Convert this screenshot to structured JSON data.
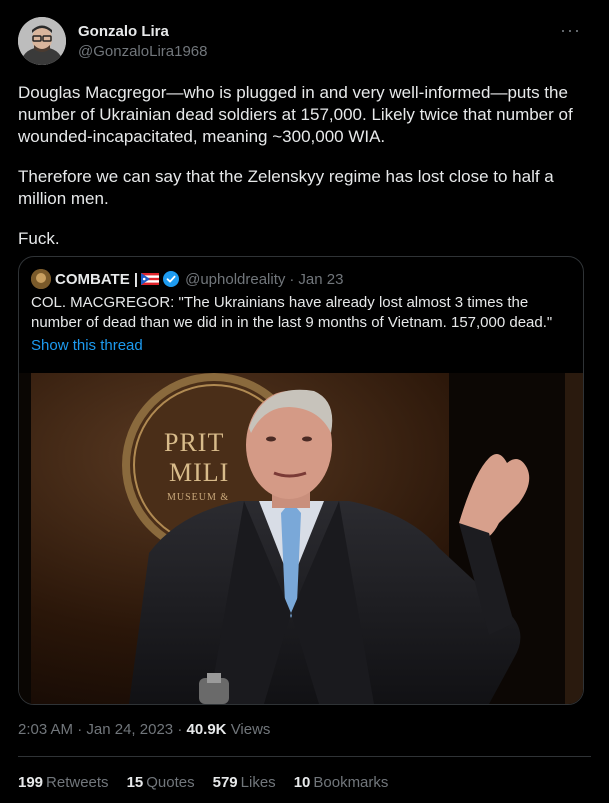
{
  "author": {
    "name": "Gonzalo Lira",
    "handle": "@GonzaloLira1968",
    "more_icon": "···"
  },
  "tweet": {
    "paragraphs": [
      "Douglas Macgregor—who is plugged in and very well-informed—puts the number of Ukrainian dead soldiers at 157,000. Likely twice that number of wounded-incapacitated, meaning ~300,000 WIA.",
      "Therefore we can say that the Zelenskyy regime has lost close to half a million men.",
      "Fuck."
    ]
  },
  "quoted": {
    "name": "COMBATE |",
    "handle": "@upholdreality",
    "separator": "·",
    "date": "Jan 23",
    "text": "COL. MACGREGOR: \"The Ukrainians have already lost almost 3 times the number of dead than we did in in the last 9 months of Vietnam. 157,000 dead.\"",
    "show_thread": "Show this thread",
    "media_sign_lines": [
      "PRIT",
      "MILI",
      "MUSEUM &"
    ],
    "colors": {
      "verified": "#1d9bf0",
      "link": "#1d9bf0"
    }
  },
  "meta": {
    "time": "2:03 AM",
    "sep1": "·",
    "date": "Jan 24, 2023",
    "sep2": "·",
    "views_count": "40.9K",
    "views_label": "Views"
  },
  "stats": {
    "retweets": {
      "count": "199",
      "label": "Retweets"
    },
    "quotes": {
      "count": "15",
      "label": "Quotes"
    },
    "likes": {
      "count": "579",
      "label": "Likes"
    },
    "bookmarks": {
      "count": "10",
      "label": "Bookmarks"
    }
  }
}
